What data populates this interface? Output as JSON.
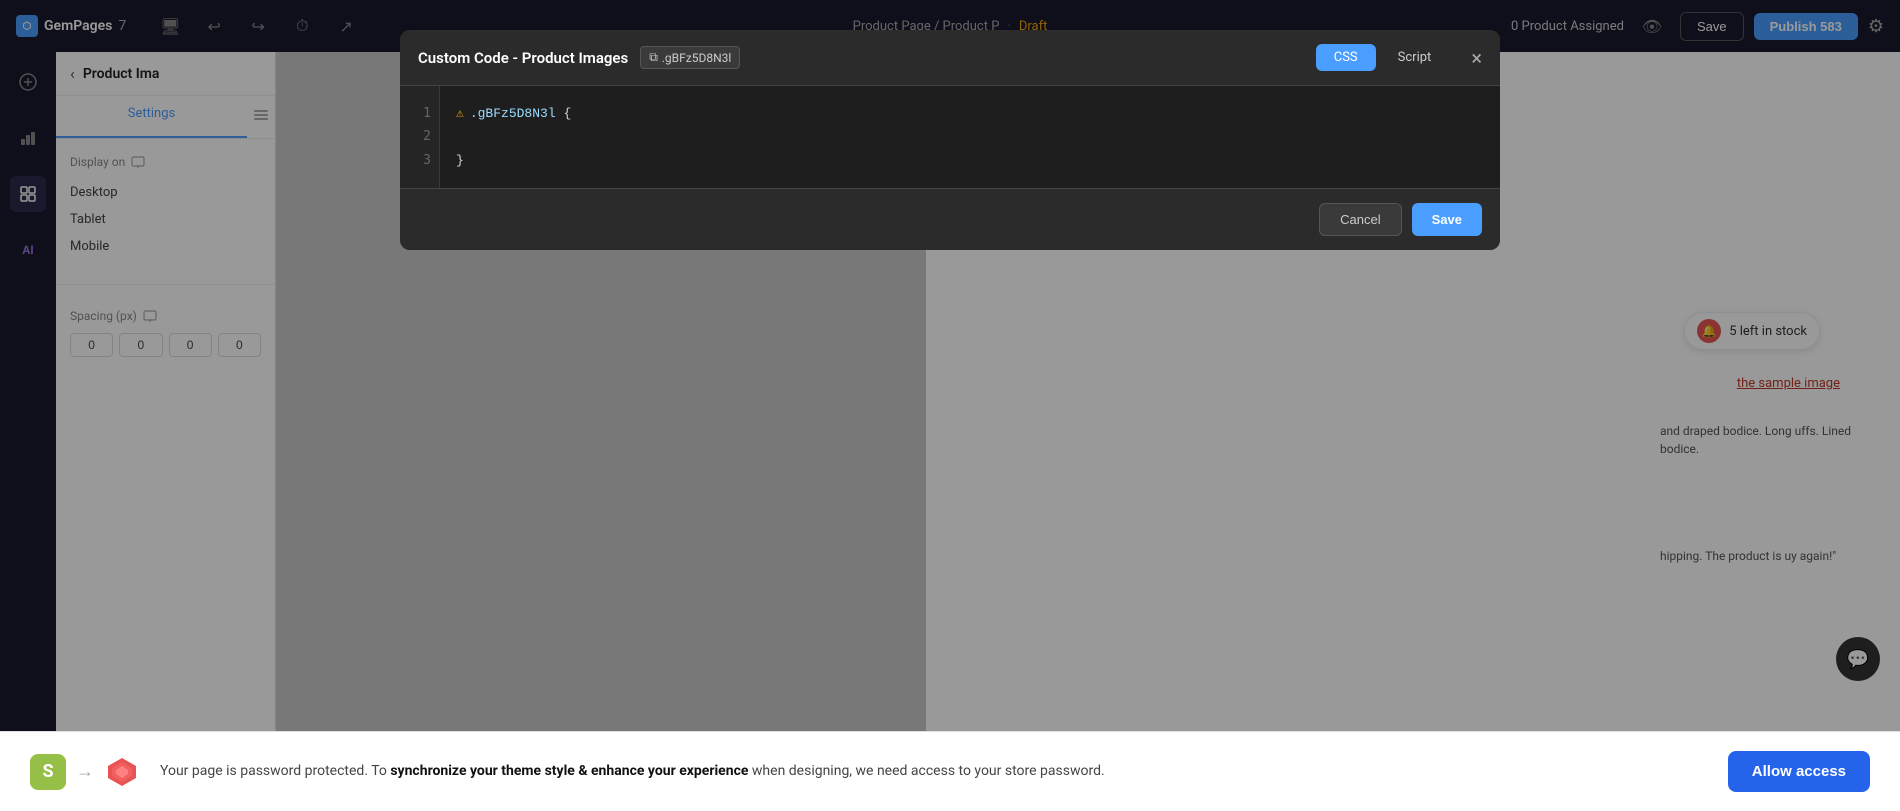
{
  "app": {
    "name": "GemPages",
    "version": "7",
    "title": "Product Page / Product P",
    "status": "Draft",
    "product_assigned": "0 Product Assigned"
  },
  "topbar": {
    "save_label": "Save",
    "publish_label": "Publish 583",
    "settings_icon": "⚙"
  },
  "panel": {
    "title": "Product Ima",
    "tabs": [
      {
        "label": "Settings",
        "active": true
      },
      {
        "label": ""
      }
    ],
    "display_on_label": "Display on",
    "desktop_label": "Desktop",
    "tablet_label": "Tablet",
    "mobile_label": "Mobile",
    "spacing_label": "Spacing (px)",
    "spacing_values": [
      "0",
      "0",
      "0",
      "0"
    ]
  },
  "modal": {
    "title": "Custom Code - Product Images",
    "copy_badge": ".gBFz5D8N3l",
    "tabs": [
      {
        "label": "CSS",
        "active": true
      },
      {
        "label": "Script",
        "active": false
      }
    ],
    "code_lines": [
      {
        "number": "1",
        "warning": true,
        "content": ".gBFz5D8N3l {"
      },
      {
        "number": "2",
        "warning": false,
        "content": ""
      },
      {
        "number": "3",
        "warning": false,
        "content": "}"
      }
    ],
    "cancel_label": "Cancel",
    "save_label": "Save"
  },
  "canvas": {
    "stock_badge": "5 left in stock",
    "sample_image_text": "the sample image",
    "product_desc": "and draped bodice. Long uffs. Lined bodice.",
    "product_note": "hipping. The product is uy again!\""
  },
  "banner": {
    "arrow": "→",
    "message": "Your page is password protected. To ",
    "message_bold": "synchronize your theme style & enhance your experience",
    "message_end": " when designing, we need access to your store password.",
    "allow_access_label": "Allow access"
  },
  "icons": {
    "add": "+",
    "chart": "📊",
    "layout": "⊞",
    "ai": "AI",
    "back": "‹",
    "monitor": "🖥",
    "more": "···",
    "copy": "⧉",
    "close": "×",
    "warning": "⚠",
    "chat": "💬"
  }
}
